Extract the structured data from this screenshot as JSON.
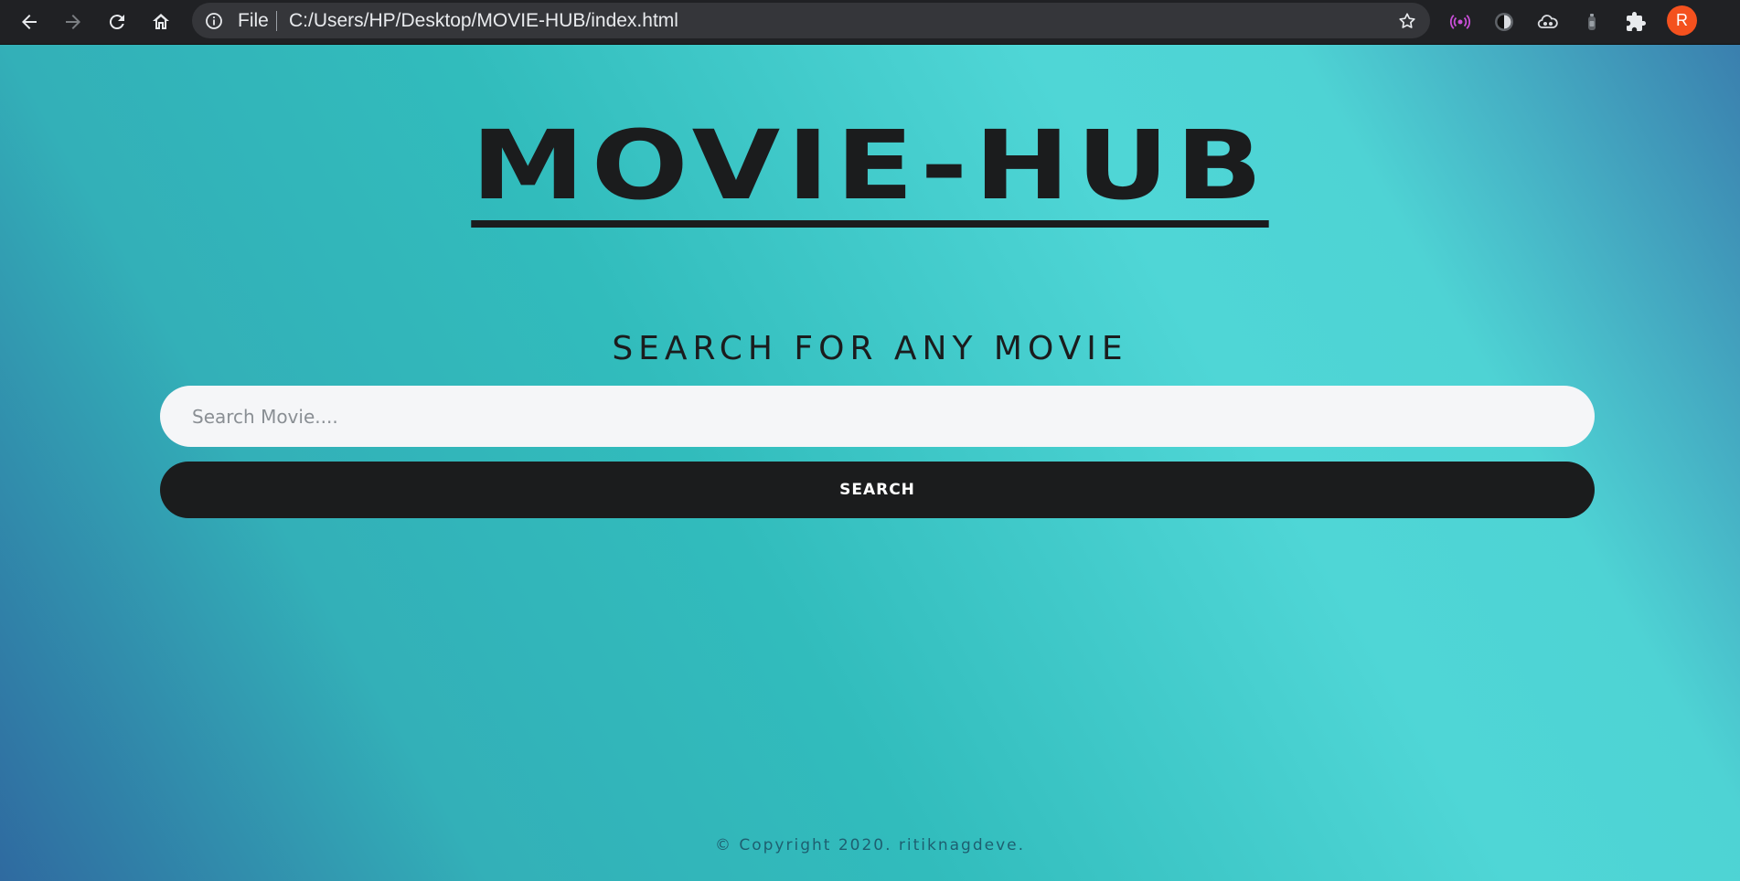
{
  "browser": {
    "scheme_label": "File",
    "url": "C:/Users/HP/Desktop/MOVIE-HUB/index.html",
    "profile_initial": "R",
    "profile_color": "#f4511e"
  },
  "page": {
    "brand_title": "MOVIE-HUB",
    "subtitle": "SEARCH FOR ANY MOVIE",
    "search_placeholder": "Search Movie....",
    "search_button_label": "SEARCH",
    "footer_text": "© Copyright 2020. ritiknagdeve."
  },
  "icons": [
    "back-icon",
    "forward-icon",
    "reload-icon",
    "home-icon",
    "info-icon",
    "star-icon",
    "extension-broadcast-icon",
    "extension-dark-mode-icon",
    "extension-cloud-icon",
    "extension-bottle-icon",
    "extensions-puzzle-icon"
  ]
}
